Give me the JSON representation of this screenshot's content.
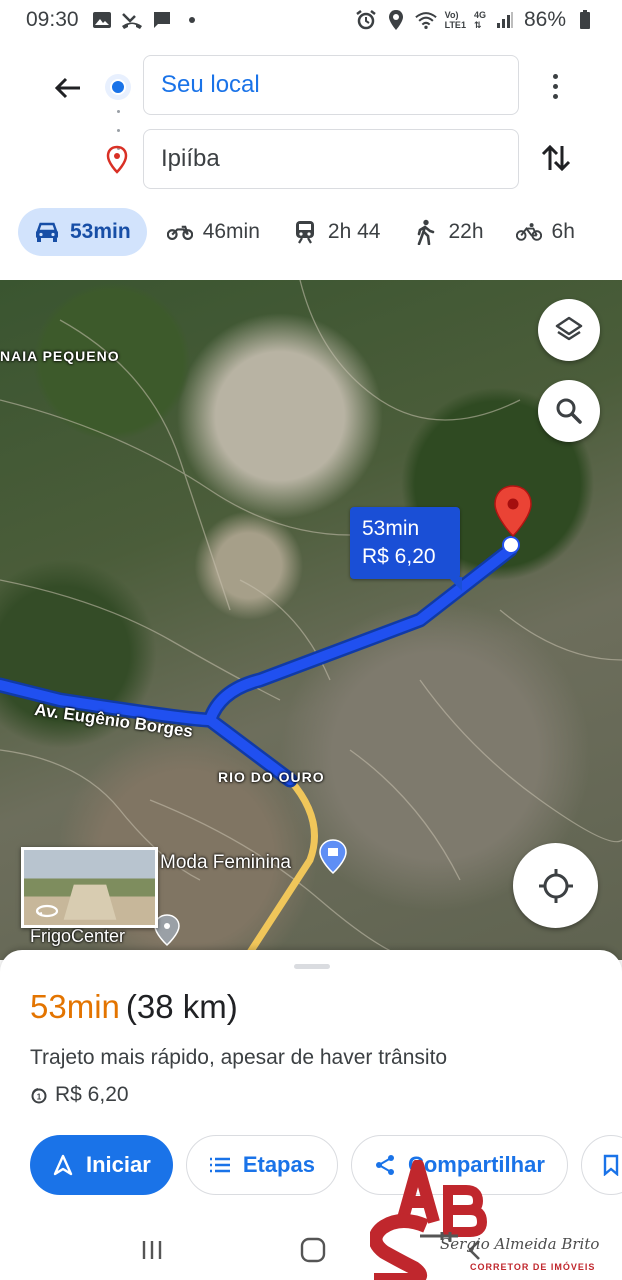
{
  "status_bar": {
    "time": "09:30",
    "battery": "86%",
    "network_top": "Vo)",
    "network_bottom": "LTE1",
    "net_type": "4G"
  },
  "directions": {
    "origin": "Seu local",
    "destination": "Ipiíba",
    "modes": [
      {
        "icon": "car-icon",
        "label": "53min",
        "active": true
      },
      {
        "icon": "motorcycle-icon",
        "label": "46min",
        "active": false
      },
      {
        "icon": "train-icon",
        "label": "2h 44",
        "active": false
      },
      {
        "icon": "walk-icon",
        "label": "22h",
        "active": false
      },
      {
        "icon": "bike-icon",
        "label": "6h",
        "active": false
      }
    ]
  },
  "map": {
    "labels": {
      "naia": "NAIA PEQUENO",
      "street": "Av. Eugênio Borges",
      "rio": "RIO DO OURO",
      "moda": "Moda Feminina",
      "frigo": "FrigoCenter"
    },
    "route_bubble": {
      "time": "53min",
      "cost": "R$ 6,20"
    },
    "route_color": "#2050f0",
    "pin_color": "#ea4335"
  },
  "sheet": {
    "duration": "53min",
    "distance": "(38 km)",
    "subtitle": "Trajeto mais rápido, apesar de haver trânsito",
    "toll": "R$ 6,20",
    "actions": {
      "start": "Iniciar",
      "steps": "Etapas",
      "share": "Compartilhar"
    }
  },
  "watermark": {
    "name": "Sergio Almeida Brito",
    "subtitle": "CORRETOR DE IMÓVEIS"
  },
  "colors": {
    "accent": "#1a73e8",
    "duration": "#e37400",
    "active_mode_bg": "#d2e3fc"
  }
}
